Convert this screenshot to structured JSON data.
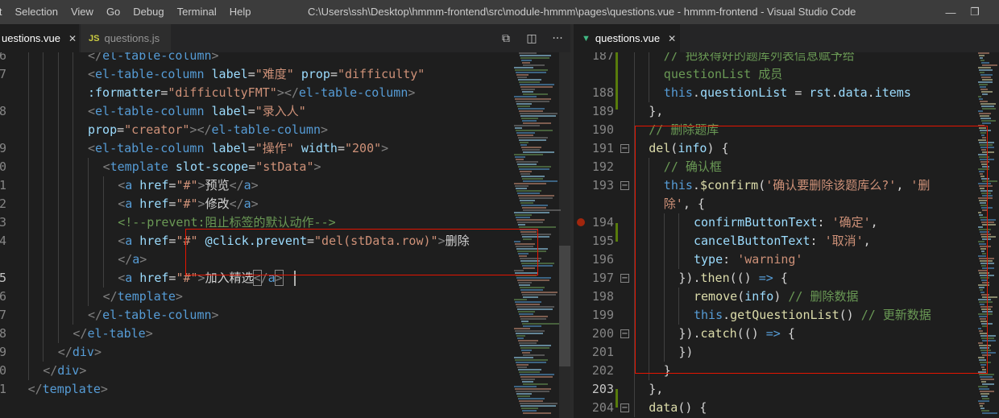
{
  "menu": [
    "it",
    "Selection",
    "View",
    "Go",
    "Debug",
    "Terminal",
    "Help"
  ],
  "window_title": "C:\\Users\\ssh\\Desktop\\hmmm-frontend\\src\\module-hmmm\\pages\\questions.vue - hmmm-frontend - Visual Studio Code",
  "window_controls": {
    "minimize": "—",
    "restore": "❐"
  },
  "left_tabs": [
    {
      "label": "uestions.vue",
      "close": "✕"
    },
    {
      "badge": "JS",
      "label": "questions.js"
    }
  ],
  "left_actions": [
    "⧉",
    "◫",
    "···"
  ],
  "right_tab": {
    "badge": "▼",
    "label": "questions.vue",
    "close": "✕"
  },
  "colors": {
    "accent_red": "#e51400",
    "git_added": "#587c0c",
    "breakpoint": "#a1260d"
  },
  "left_lines": [
    {
      "num": "6",
      "indent": 5,
      "parts": [
        [
          "t-br",
          "</"
        ],
        [
          "t-tag",
          "el-table-column"
        ],
        [
          "t-br",
          ">"
        ]
      ]
    },
    {
      "num": "7",
      "indent": 5,
      "parts": [
        [
          "t-br",
          "<"
        ],
        [
          "t-tag",
          "el-table-column"
        ],
        [
          "t-txt",
          " "
        ],
        [
          "t-attr",
          "label"
        ],
        [
          "t-txt",
          "="
        ],
        [
          "t-str",
          "\"难度\""
        ],
        [
          "t-txt",
          " "
        ],
        [
          "t-attr",
          "prop"
        ],
        [
          "t-txt",
          "="
        ],
        [
          "t-str",
          "\"difficulty\""
        ]
      ]
    },
    {
      "num": "",
      "indent": 5,
      "parts": [
        [
          "t-attr",
          ":formatter"
        ],
        [
          "t-txt",
          "="
        ],
        [
          "t-str",
          "\"difficultyFMT\""
        ],
        [
          "t-br",
          "></"
        ],
        [
          "t-tag",
          "el-table-column"
        ],
        [
          "t-br",
          ">"
        ]
      ]
    },
    {
      "num": "8",
      "indent": 5,
      "parts": [
        [
          "t-br",
          "<"
        ],
        [
          "t-tag",
          "el-table-column"
        ],
        [
          "t-txt",
          " "
        ],
        [
          "t-attr",
          "label"
        ],
        [
          "t-txt",
          "="
        ],
        [
          "t-str",
          "\"录入人\""
        ]
      ]
    },
    {
      "num": "",
      "indent": 5,
      "parts": [
        [
          "t-attr",
          "prop"
        ],
        [
          "t-txt",
          "="
        ],
        [
          "t-str",
          "\"creator\""
        ],
        [
          "t-br",
          "></"
        ],
        [
          "t-tag",
          "el-table-column"
        ],
        [
          "t-br",
          ">"
        ]
      ]
    },
    {
      "num": "9",
      "indent": 5,
      "parts": [
        [
          "t-br",
          "<"
        ],
        [
          "t-tag",
          "el-table-column"
        ],
        [
          "t-txt",
          " "
        ],
        [
          "t-attr",
          "label"
        ],
        [
          "t-txt",
          "="
        ],
        [
          "t-str",
          "\"操作\""
        ],
        [
          "t-txt",
          " "
        ],
        [
          "t-attr",
          "width"
        ],
        [
          "t-txt",
          "="
        ],
        [
          "t-str",
          "\"200\""
        ],
        [
          "t-br",
          ">"
        ]
      ]
    },
    {
      "num": "0",
      "indent": 6,
      "parts": [
        [
          "t-br",
          "<"
        ],
        [
          "t-tag",
          "template"
        ],
        [
          "t-txt",
          " "
        ],
        [
          "t-attr",
          "slot-scope"
        ],
        [
          "t-txt",
          "="
        ],
        [
          "t-str",
          "\"stData\""
        ],
        [
          "t-br",
          ">"
        ]
      ]
    },
    {
      "num": "1",
      "indent": 7,
      "parts": [
        [
          "t-br",
          "<"
        ],
        [
          "t-tag",
          "a"
        ],
        [
          "t-txt",
          " "
        ],
        [
          "t-attr",
          "href"
        ],
        [
          "t-txt",
          "="
        ],
        [
          "t-str",
          "\"#\""
        ],
        [
          "t-br",
          ">"
        ],
        [
          "t-txt",
          "预览"
        ],
        [
          "t-br",
          "</"
        ],
        [
          "t-tag",
          "a"
        ],
        [
          "t-br",
          ">"
        ]
      ]
    },
    {
      "num": "2",
      "indent": 7,
      "parts": [
        [
          "t-br",
          "<"
        ],
        [
          "t-tag",
          "a"
        ],
        [
          "t-txt",
          " "
        ],
        [
          "t-attr",
          "href"
        ],
        [
          "t-txt",
          "="
        ],
        [
          "t-str",
          "\"#\""
        ],
        [
          "t-br",
          ">"
        ],
        [
          "t-txt",
          "修改"
        ],
        [
          "t-br",
          "</"
        ],
        [
          "t-tag",
          "a"
        ],
        [
          "t-br",
          ">"
        ]
      ]
    },
    {
      "num": "3",
      "indent": 7,
      "parts": [
        [
          "t-cmt",
          "<!--prevent:阻止标签的默认动作-->"
        ]
      ]
    },
    {
      "num": "4",
      "indent": 7,
      "parts": [
        [
          "t-br",
          "<"
        ],
        [
          "t-tag",
          "a"
        ],
        [
          "t-txt",
          " "
        ],
        [
          "t-attr",
          "href"
        ],
        [
          "t-txt",
          "="
        ],
        [
          "t-str",
          "\"#\""
        ],
        [
          "t-txt",
          " "
        ],
        [
          "t-attr",
          "@click.prevent"
        ],
        [
          "t-txt",
          "="
        ],
        [
          "t-str",
          "\"del(stData.row)\""
        ],
        [
          "t-br",
          ">"
        ],
        [
          "t-txt",
          "删除"
        ]
      ]
    },
    {
      "num": "",
      "indent": 7,
      "parts": [
        [
          "t-br",
          "</"
        ],
        [
          "t-tag",
          "a"
        ],
        [
          "t-br",
          ">"
        ]
      ]
    },
    {
      "num": "5",
      "indent": 7,
      "current": true,
      "parts": [
        [
          "t-br",
          "<"
        ],
        [
          "t-tag",
          "a"
        ],
        [
          "t-txt",
          " "
        ],
        [
          "t-attr",
          "href"
        ],
        [
          "t-txt",
          "="
        ],
        [
          "t-str",
          "\"#\""
        ],
        [
          "t-br",
          ">"
        ],
        [
          "t-txt",
          "加入精选"
        ],
        [
          "t-br bracket",
          "<"
        ],
        [
          "t-br",
          "/"
        ],
        [
          "t-tag",
          "a"
        ],
        [
          "t-br bracket",
          ">"
        ]
      ]
    },
    {
      "num": "6",
      "indent": 6,
      "parts": [
        [
          "t-br",
          "</"
        ],
        [
          "t-tag",
          "template"
        ],
        [
          "t-br",
          ">"
        ]
      ]
    },
    {
      "num": "7",
      "indent": 5,
      "parts": [
        [
          "t-br",
          "</"
        ],
        [
          "t-tag",
          "el-table-column"
        ],
        [
          "t-br",
          ">"
        ]
      ]
    },
    {
      "num": "8",
      "indent": 4,
      "parts": [
        [
          "t-br",
          "</"
        ],
        [
          "t-tag",
          "el-table"
        ],
        [
          "t-br",
          ">"
        ]
      ]
    },
    {
      "num": "9",
      "indent": 3,
      "parts": [
        [
          "t-br",
          "</"
        ],
        [
          "t-tag",
          "div"
        ],
        [
          "t-br",
          ">"
        ]
      ]
    },
    {
      "num": "0",
      "indent": 2,
      "parts": [
        [
          "t-br",
          "</"
        ],
        [
          "t-tag",
          "div"
        ],
        [
          "t-br",
          ">"
        ]
      ]
    },
    {
      "num": "1",
      "indent": 1,
      "parts": [
        [
          "t-br",
          "</"
        ],
        [
          "t-tag",
          "template"
        ],
        [
          "t-br",
          ">"
        ]
      ]
    }
  ],
  "right_lines": [
    {
      "num": "187",
      "indent": 3,
      "parts": [
        [
          "t-cmt",
          "// 把获得好的题库列表信息赋予给"
        ]
      ]
    },
    {
      "num": "",
      "indent": 3,
      "parts": [
        [
          "t-cmt",
          "questionList 成员"
        ]
      ]
    },
    {
      "num": "188",
      "indent": 3,
      "parts": [
        [
          "t-kw",
          "this"
        ],
        [
          "t-txt",
          "."
        ],
        [
          "t-key",
          "questionList"
        ],
        [
          "t-txt",
          " = "
        ],
        [
          "t-key",
          "rst"
        ],
        [
          "t-txt",
          "."
        ],
        [
          "t-key",
          "data"
        ],
        [
          "t-txt",
          "."
        ],
        [
          "t-key",
          "items"
        ]
      ]
    },
    {
      "num": "189",
      "indent": 2,
      "parts": [
        [
          "t-txt",
          "},"
        ]
      ]
    },
    {
      "num": "190",
      "indent": 2,
      "parts": [
        [
          "t-cmt",
          "// 删除题库"
        ]
      ]
    },
    {
      "num": "191",
      "indent": 2,
      "fold": true,
      "parts": [
        [
          "t-fn",
          "del"
        ],
        [
          "t-txt",
          "("
        ],
        [
          "t-key",
          "info"
        ],
        [
          "t-txt",
          ") {"
        ]
      ]
    },
    {
      "num": "192",
      "indent": 3,
      "parts": [
        [
          "t-cmt",
          "// 确认框"
        ]
      ]
    },
    {
      "num": "193",
      "indent": 3,
      "fold": true,
      "parts": [
        [
          "t-kw",
          "this"
        ],
        [
          "t-txt",
          "."
        ],
        [
          "t-fn",
          "$confirm"
        ],
        [
          "t-txt",
          "("
        ],
        [
          "t-str",
          "'确认要删除该题库么?'"
        ],
        [
          "t-txt",
          ", "
        ],
        [
          "t-str",
          "'删"
        ]
      ]
    },
    {
      "num": "",
      "indent": 3,
      "parts": [
        [
          "t-str",
          "除'"
        ],
        [
          "t-txt",
          ", {"
        ]
      ]
    },
    {
      "num": "194",
      "indent": 5,
      "breakpoint": true,
      "parts": [
        [
          "t-key",
          "confirmButtonText"
        ],
        [
          "t-txt",
          ": "
        ],
        [
          "t-str",
          "'确定'"
        ],
        [
          "t-txt",
          ","
        ]
      ]
    },
    {
      "num": "195",
      "indent": 5,
      "parts": [
        [
          "t-key",
          "cancelButtonText"
        ],
        [
          "t-txt",
          ": "
        ],
        [
          "t-str",
          "'取消'"
        ],
        [
          "t-txt",
          ","
        ]
      ]
    },
    {
      "num": "196",
      "indent": 5,
      "parts": [
        [
          "t-key",
          "type"
        ],
        [
          "t-txt",
          ": "
        ],
        [
          "t-str",
          "'warning'"
        ]
      ]
    },
    {
      "num": "197",
      "indent": 4,
      "fold": true,
      "parts": [
        [
          "t-txt",
          "})."
        ],
        [
          "t-fn",
          "then"
        ],
        [
          "t-txt",
          "(() "
        ],
        [
          "t-kw",
          "=>"
        ],
        [
          "t-txt",
          " {"
        ]
      ]
    },
    {
      "num": "198",
      "indent": 5,
      "parts": [
        [
          "t-fn",
          "remove"
        ],
        [
          "t-txt",
          "("
        ],
        [
          "t-key",
          "info"
        ],
        [
          "t-txt",
          ") "
        ],
        [
          "t-cmt",
          "// 删除数据"
        ]
      ]
    },
    {
      "num": "199",
      "indent": 5,
      "parts": [
        [
          "t-kw",
          "this"
        ],
        [
          "t-txt",
          "."
        ],
        [
          "t-fn",
          "getQuestionList"
        ],
        [
          "t-txt",
          "() "
        ],
        [
          "t-cmt",
          "// 更新数据"
        ]
      ]
    },
    {
      "num": "200",
      "indent": 4,
      "fold": true,
      "parts": [
        [
          "t-txt",
          "})."
        ],
        [
          "t-fn",
          "catch"
        ],
        [
          "t-txt",
          "(() "
        ],
        [
          "t-kw",
          "=>"
        ],
        [
          "t-txt",
          " {"
        ]
      ]
    },
    {
      "num": "201",
      "indent": 4,
      "parts": [
        [
          "t-txt",
          "})"
        ]
      ]
    },
    {
      "num": "202",
      "indent": 3,
      "parts": [
        [
          "t-txt",
          "}"
        ]
      ]
    },
    {
      "num": "203",
      "indent": 2,
      "current": true,
      "parts": [
        [
          "t-txt",
          "},"
        ]
      ]
    },
    {
      "num": "204",
      "indent": 2,
      "fold": true,
      "parts": [
        [
          "t-fn",
          "data"
        ],
        [
          "t-txt",
          "() {"
        ]
      ]
    }
  ]
}
